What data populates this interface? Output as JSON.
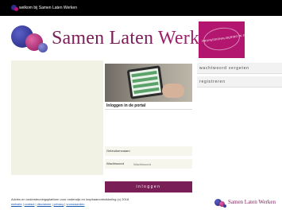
{
  "window": {
    "title": "welkom bij Samen Laten Werken"
  },
  "header": {
    "brand_part1": "Samen Laten ",
    "brand_part2": "Werken",
    "promo_text": "PROFESSIONALISERING IN JE BEROEP"
  },
  "login": {
    "title": "Inloggen in de portal",
    "username_label": "Gebruikersnaam",
    "username_value": "",
    "password_label": "Wachtwoord",
    "password_placeholder": "Wachtwoord",
    "submit_label": "inloggen"
  },
  "sidebar": {
    "forgot_password": "wachtwoord vergeten",
    "register": "registreren"
  },
  "footer": {
    "description": "Advies en ondersteuningsplatform voor onderwijs en loopbaanontwikkeling (c) 2018",
    "links": [
      "website",
      "contact",
      "disclaimer",
      "privacy",
      "voorwaarden"
    ],
    "brand": "Samen Laten Werken"
  },
  "colors": {
    "brand": "#7a1e58",
    "promo": "#b3166f",
    "topbar": "#000000"
  }
}
